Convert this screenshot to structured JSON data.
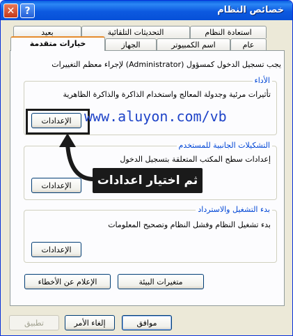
{
  "window": {
    "title": "خصائص النظام"
  },
  "titlebar_buttons": {
    "help": "?",
    "close": "✕"
  },
  "tabs": [
    {
      "label": "استعادة النظام"
    },
    {
      "label": "التحديثات التلقائية"
    },
    {
      "label": "بعيد"
    },
    {
      "label": "عام"
    },
    {
      "label": "اسم الكمبيوتر"
    },
    {
      "label": "الجهاز"
    },
    {
      "label": "خيارات متقدمة"
    }
  ],
  "admin_note": "يجب تسجيل الدخول كمسؤول (Administrator) لإجراء معظم التغييرات",
  "groups": {
    "performance": {
      "title": "الأداء",
      "desc": "تأثيرات مرئية وجدولة المعالج واستخدام الذاكرة والذاكرة الظاهرية",
      "button": "الإعدادات"
    },
    "profiles": {
      "title": "التشكيلات الجانبية للمستخدم",
      "desc": "إعدادات سطح المكتب المتعلقة بتسجيل الدخول",
      "button": "الإعدادات"
    },
    "startup": {
      "title": "بدء التشغيل والاسترداد",
      "desc": "بدء تشغيل النظام وفشل النظام وتصحيح المعلومات",
      "button": "الإعدادات"
    }
  },
  "panel_buttons": {
    "env_vars": "متغيرات البيئة",
    "error_reporting": "الإعلام عن الأخطاء"
  },
  "dialog_buttons": {
    "ok": "موافق",
    "cancel": "إلغاء الأمر",
    "apply": "تطبيق"
  },
  "overlay": {
    "url": "www.aluyon.com/vb",
    "callout": "ثم اختيار اعدادات"
  }
}
